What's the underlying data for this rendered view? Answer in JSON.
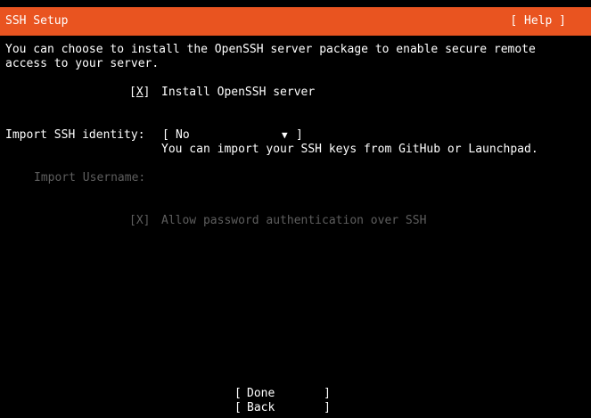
{
  "header": {
    "title": "SSH Setup",
    "help_label": "[ Help ]"
  },
  "colors": {
    "header_bg": "#e95420",
    "background": "#000000",
    "text": "#ffffff",
    "disabled_text": "#5e5e5e"
  },
  "intro": {
    "line1": "You can choose to install the OpenSSH server package to enable secure remote",
    "line2": "access to your server."
  },
  "install_openssh": {
    "checkbox_open": "[",
    "checkbox_mark": "X",
    "checkbox_close": "]",
    "label": "Install OpenSSH server"
  },
  "import_identity": {
    "label": "Import SSH identity:",
    "bracket_open": "[",
    "selected": "No",
    "arrow_icon": "▼",
    "bracket_close": "]",
    "hint": "You can import your SSH keys from GitHub or Launchpad."
  },
  "import_username": {
    "label": "Import Username:",
    "value": ""
  },
  "password_auth": {
    "checkbox": "[X]",
    "label": "Allow password authentication over SSH"
  },
  "buttons": {
    "bracket_open": "[",
    "bracket_close": "]",
    "done": "Done",
    "back": "Back"
  }
}
